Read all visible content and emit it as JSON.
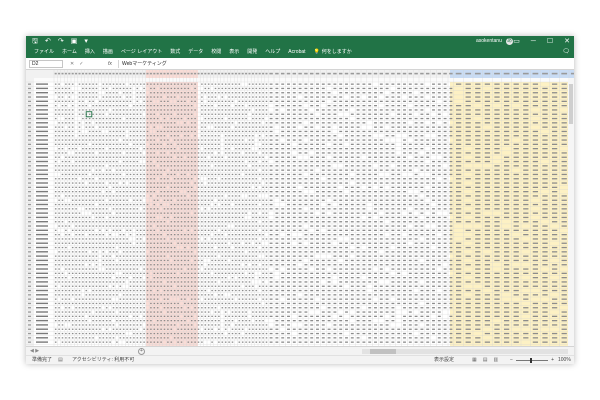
{
  "qat": {
    "save_icon": "save-icon",
    "undo_icon": "undo-icon",
    "redo_icon": "redo-icon",
    "camera_icon": "camera-icon",
    "customize_icon": "dropdown-arrow-icon"
  },
  "user": {
    "name": "asokentanu",
    "initial": "あ"
  },
  "window_controls": {
    "ribbon_options": "▭",
    "minimize": "─",
    "restore": "☐",
    "close": "✕"
  },
  "ribbon": {
    "tabs": [
      "ファイル",
      "ホーム",
      "挿入",
      "描画",
      "ページ レイアウト",
      "数式",
      "データ",
      "校閲",
      "表示",
      "開発",
      "ヘルプ",
      "Acrobat"
    ],
    "tell_me": "何をしますか",
    "share_icon": "comment-icon"
  },
  "formula_bar": {
    "name_box": "D2",
    "cancel": "✕",
    "enter": "✓",
    "fx": "fx",
    "value": "Webマーケティング"
  },
  "status": {
    "ready": "準備完了",
    "accessibility": "アクセシビリティ: 利用不可",
    "display_settings": "表示設定",
    "zoom": "100%"
  },
  "colors": {
    "excel_green": "#217346",
    "highlight_red": "#f9dcd6",
    "highlight_blue": "#c9dcf4",
    "highlight_yellow": "#fdf1c4",
    "grid_line": "#d4d4d4"
  }
}
